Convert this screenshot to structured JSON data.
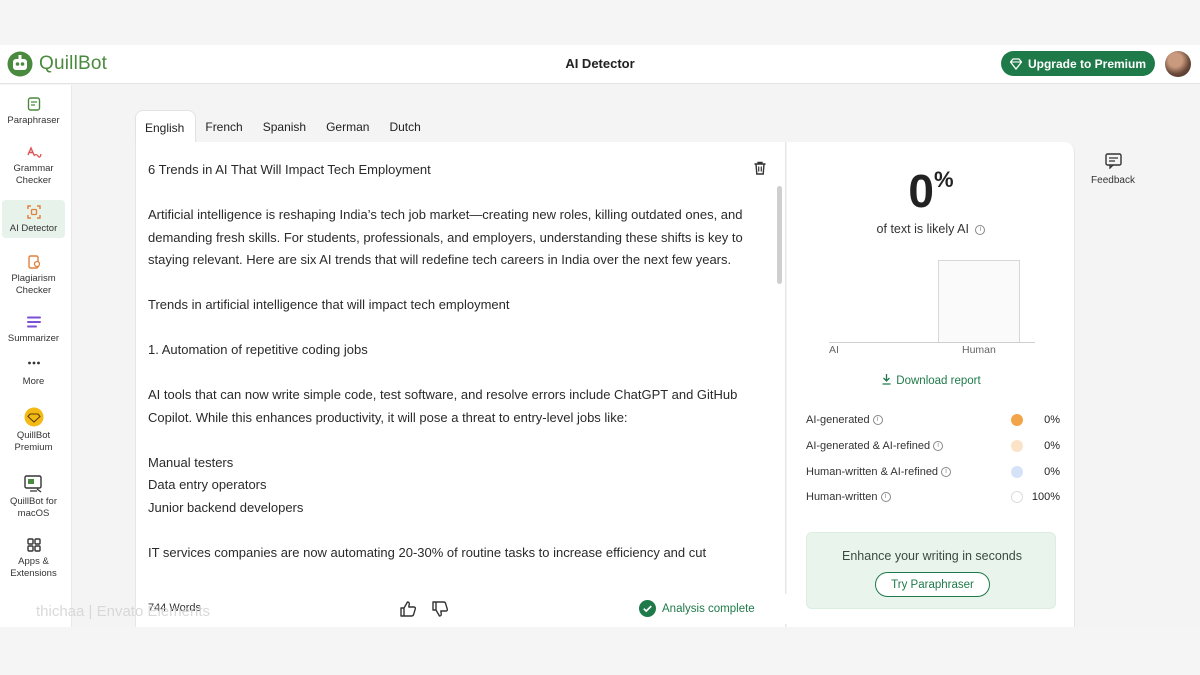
{
  "app": {
    "logo_text": "QuillBot",
    "page_title": "AI Detector",
    "upgrade_label": "Upgrade to Premium"
  },
  "sidebar": {
    "items": [
      {
        "label": "Paraphraser",
        "icon": "paraphraser-icon"
      },
      {
        "label": "Grammar Checker",
        "icon": "grammar-checker-icon"
      },
      {
        "label": "AI Detector",
        "icon": "ai-detector-icon",
        "active": true
      },
      {
        "label": "Plagiarism Checker",
        "icon": "plagiarism-checker-icon"
      },
      {
        "label": "Summarizer",
        "icon": "summarizer-icon"
      },
      {
        "label": "More",
        "icon": "more-dots-icon"
      },
      {
        "label": "QuillBot Premium",
        "icon": "premium-diamond-icon"
      },
      {
        "label": "QuillBot for macOS",
        "icon": "macos-app-icon"
      },
      {
        "label": "Apps & Extensions",
        "icon": "apps-grid-icon"
      }
    ]
  },
  "languages": {
    "tabs": [
      "English",
      "French",
      "Spanish",
      "German",
      "Dutch"
    ],
    "active": "English"
  },
  "editor": {
    "title_line": "6 Trends in AI That Will Impact Tech Employment",
    "p1": "Artificial intelligence is reshaping India’s tech job market—creating new roles, killing outdated ones, and demanding fresh skills. For students, professionals, and employers, understanding these shifts is key to staying relevant. Here are six AI trends that will redefine tech careers in India over the next few years.",
    "p2": "Trends in artificial intelligence that will impact tech employment",
    "p3": "1. Automation of repetitive coding jobs",
    "p4": "AI tools that can now write simple code, test software, and resolve errors include ChatGPT and GitHub Copilot. While this enhances productivity, it will pose a threat to entry-level jobs like:",
    "list": [
      "Manual testers",
      "Data entry operators",
      "Junior backend developers"
    ],
    "p5": "IT services companies are now automating 20-30% of routine tasks to increase efficiency and cut",
    "word_count": "744 Words",
    "status": "Analysis complete"
  },
  "results": {
    "score_value": "0",
    "score_unit": "%",
    "caption": "of text is likely AI",
    "download_label": "Download report",
    "breakdown": [
      {
        "label": "AI-generated",
        "percent": "0%",
        "color": "#f2a449"
      },
      {
        "label": "AI-generated & AI-refined",
        "percent": "0%",
        "color": "#fbe3c8"
      },
      {
        "label": "Human-written & AI-refined",
        "percent": "0%",
        "color": "#d6e2f7"
      },
      {
        "label": "Human-written",
        "percent": "100%",
        "color": "#ffffff"
      }
    ],
    "promo_text": "Enhance your writing in seconds",
    "promo_button": "Try Paraphraser"
  },
  "chart_data": {
    "type": "bar",
    "categories": [
      "AI",
      "Human"
    ],
    "values": [
      0,
      100
    ],
    "ylim": [
      0,
      100
    ],
    "grid": false
  },
  "feedback_label": "Feedback",
  "watermark": "thichaa | Envato Elements",
  "colors": {
    "brand": "#4a8a3e",
    "accent": "#1f7a4a",
    "active_bg": "#e6f2ea"
  }
}
